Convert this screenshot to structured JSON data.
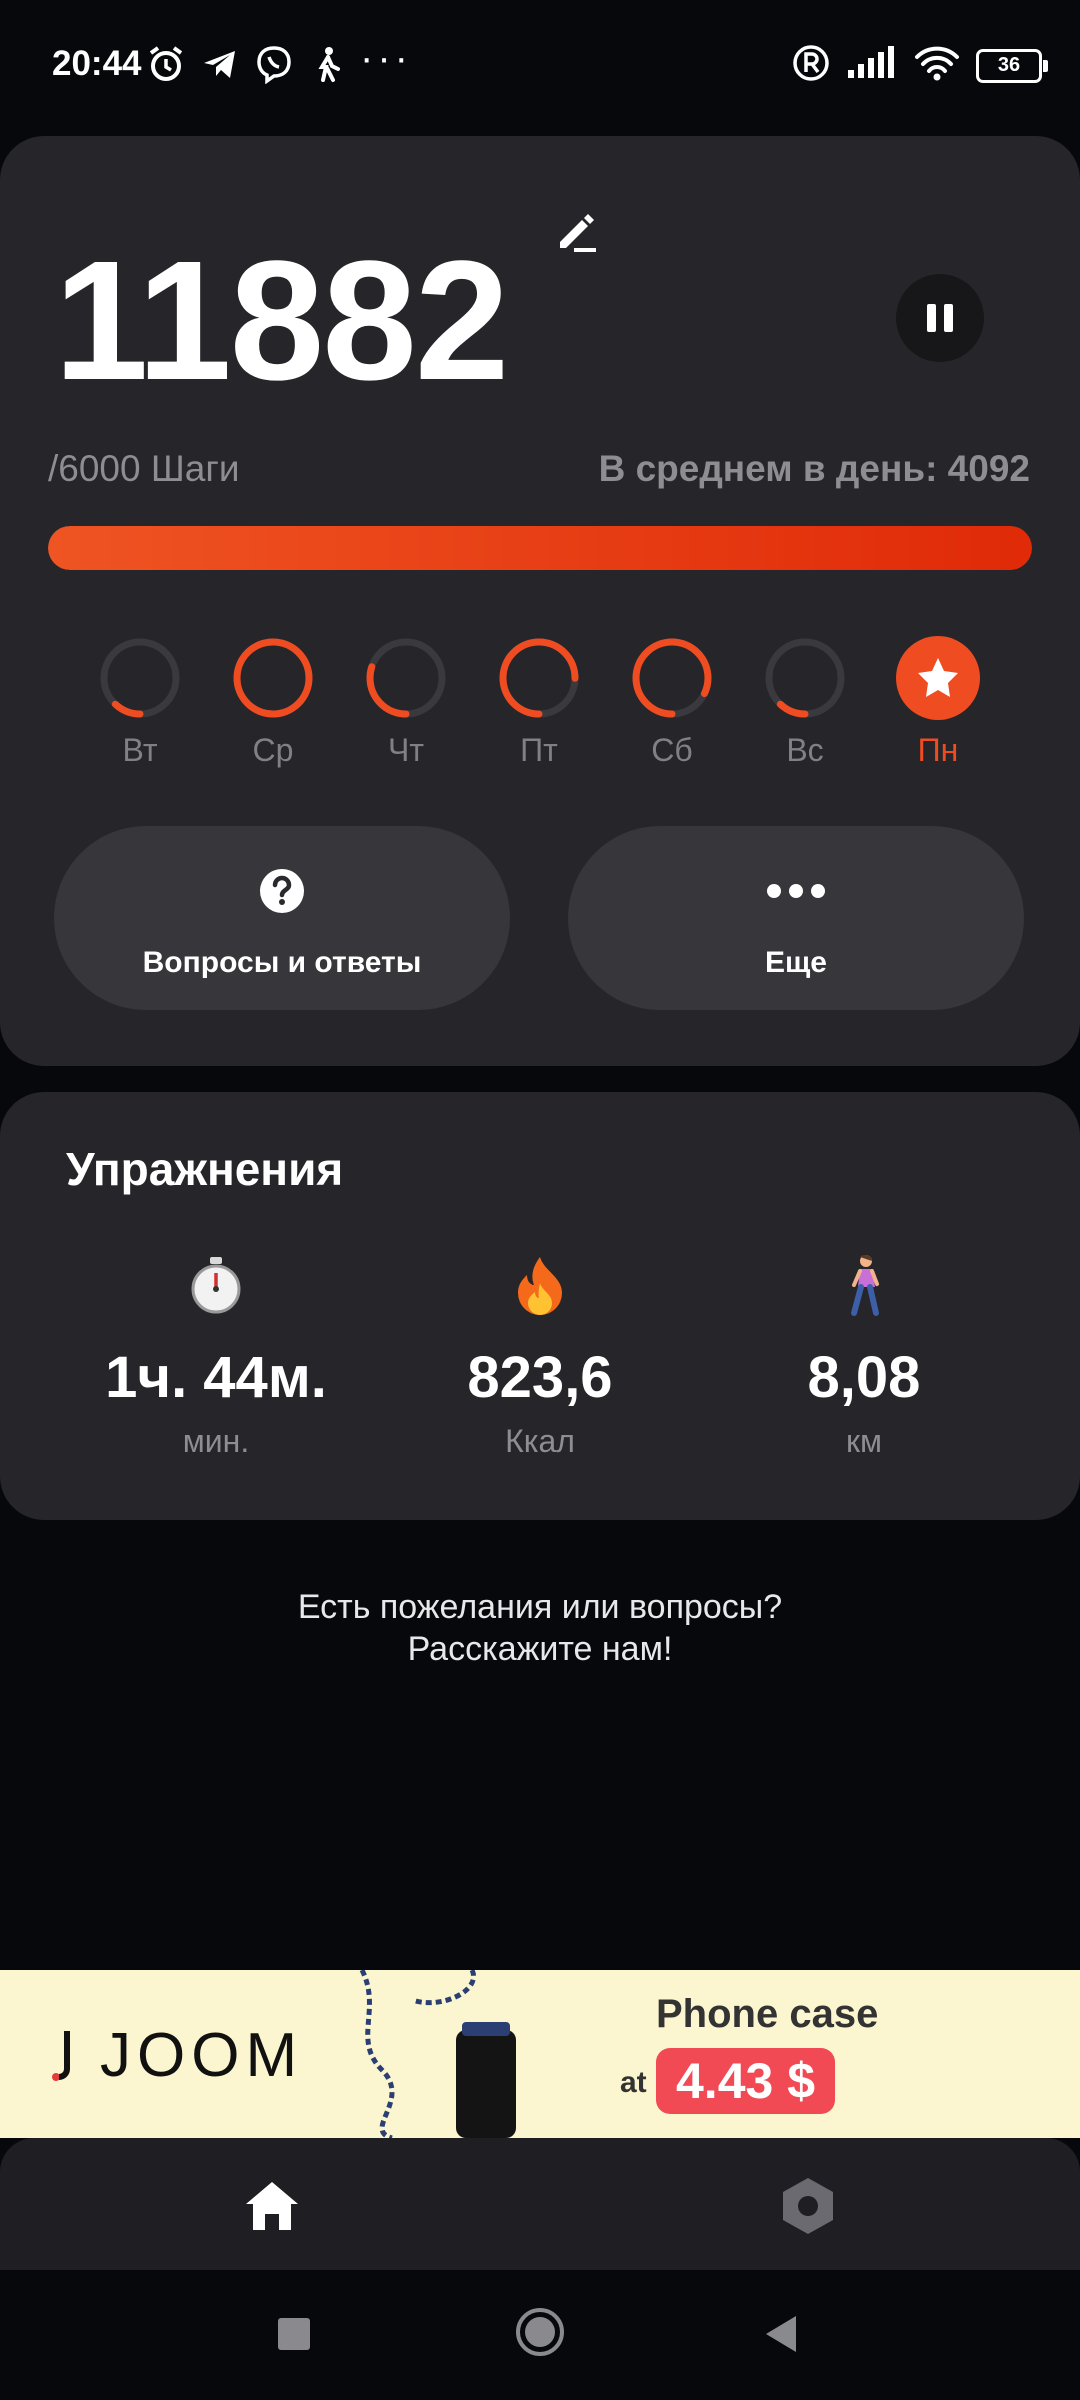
{
  "status_bar": {
    "time": "20:44",
    "icons_left": [
      "alarm-icon",
      "telegram-icon",
      "viber-icon",
      "walking-icon"
    ],
    "more": "···",
    "battery": "36"
  },
  "summary": {
    "steps": "11882",
    "goal_text": "/6000 Шаги",
    "average_text": "В среднем в день: 4092",
    "progress_fraction": 1.0,
    "accent_color": "#ef4c22"
  },
  "week": [
    {
      "label": "Вт",
      "progress": 0.12,
      "active": false
    },
    {
      "label": "Ср",
      "progress": 1.0,
      "active": false
    },
    {
      "label": "Чт",
      "progress": 0.3,
      "active": false
    },
    {
      "label": "Пт",
      "progress": 0.75,
      "active": false
    },
    {
      "label": "Сб",
      "progress": 0.82,
      "active": false
    },
    {
      "label": "Вс",
      "progress": 0.12,
      "active": false
    },
    {
      "label": "Пн",
      "progress": 1.0,
      "active": true
    }
  ],
  "actions": {
    "faq_label": "Вопросы и ответы",
    "more_label": "Еще"
  },
  "exercise": {
    "title": "Упражнения",
    "stats": [
      {
        "icon": "stopwatch-icon",
        "value": "1ч. 44м.",
        "unit": "мин."
      },
      {
        "icon": "fire-icon",
        "value": "823,6",
        "unit": "Ккал"
      },
      {
        "icon": "walker-icon",
        "value": "8,08",
        "unit": "км"
      }
    ]
  },
  "feedback": {
    "line1": "Есть пожелания или вопросы?",
    "line2": "Расскажите нам!"
  },
  "ad": {
    "brand": "JOOM",
    "title": "Phone case",
    "at": "at",
    "price": "4.43 $"
  }
}
